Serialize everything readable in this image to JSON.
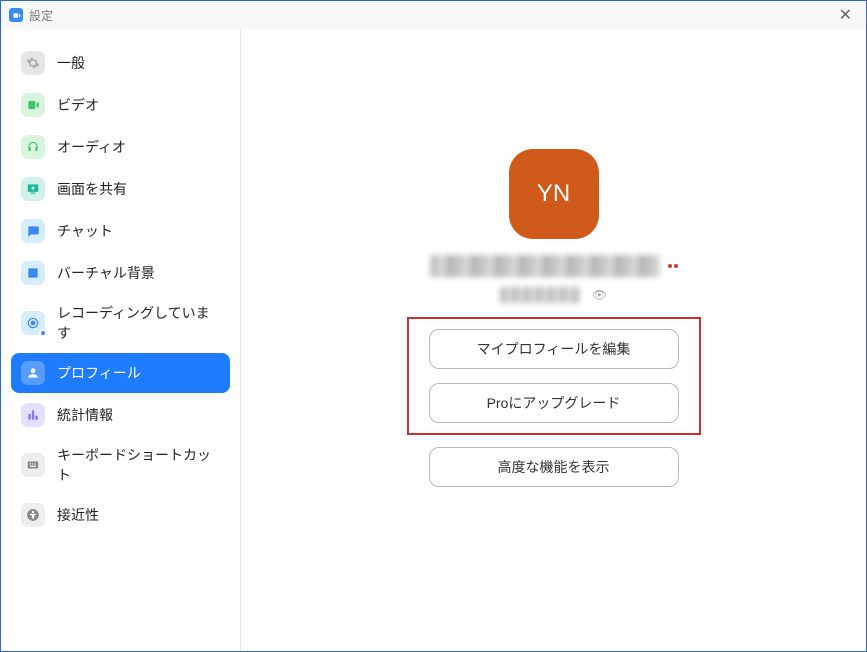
{
  "window": {
    "title": "設定"
  },
  "sidebar": {
    "items": [
      {
        "label": "一般",
        "icon": "gear"
      },
      {
        "label": "ビデオ",
        "icon": "video"
      },
      {
        "label": "オーディオ",
        "icon": "audio"
      },
      {
        "label": "画面を共有",
        "icon": "share"
      },
      {
        "label": "チャット",
        "icon": "chat"
      },
      {
        "label": "バーチャル背景",
        "icon": "vbg"
      },
      {
        "label": "レコーディングしています",
        "icon": "rec"
      },
      {
        "label": "プロフィール",
        "icon": "profile"
      },
      {
        "label": "統計情報",
        "icon": "stats"
      },
      {
        "label": "キーボードショートカット",
        "icon": "keyboard"
      },
      {
        "label": "接近性",
        "icon": "access"
      }
    ]
  },
  "profile": {
    "avatar_initials": "YN",
    "buttons": {
      "edit": "マイプロフィールを編集",
      "upgrade": "Proにアップグレード",
      "advanced": "高度な機能を表示"
    }
  }
}
